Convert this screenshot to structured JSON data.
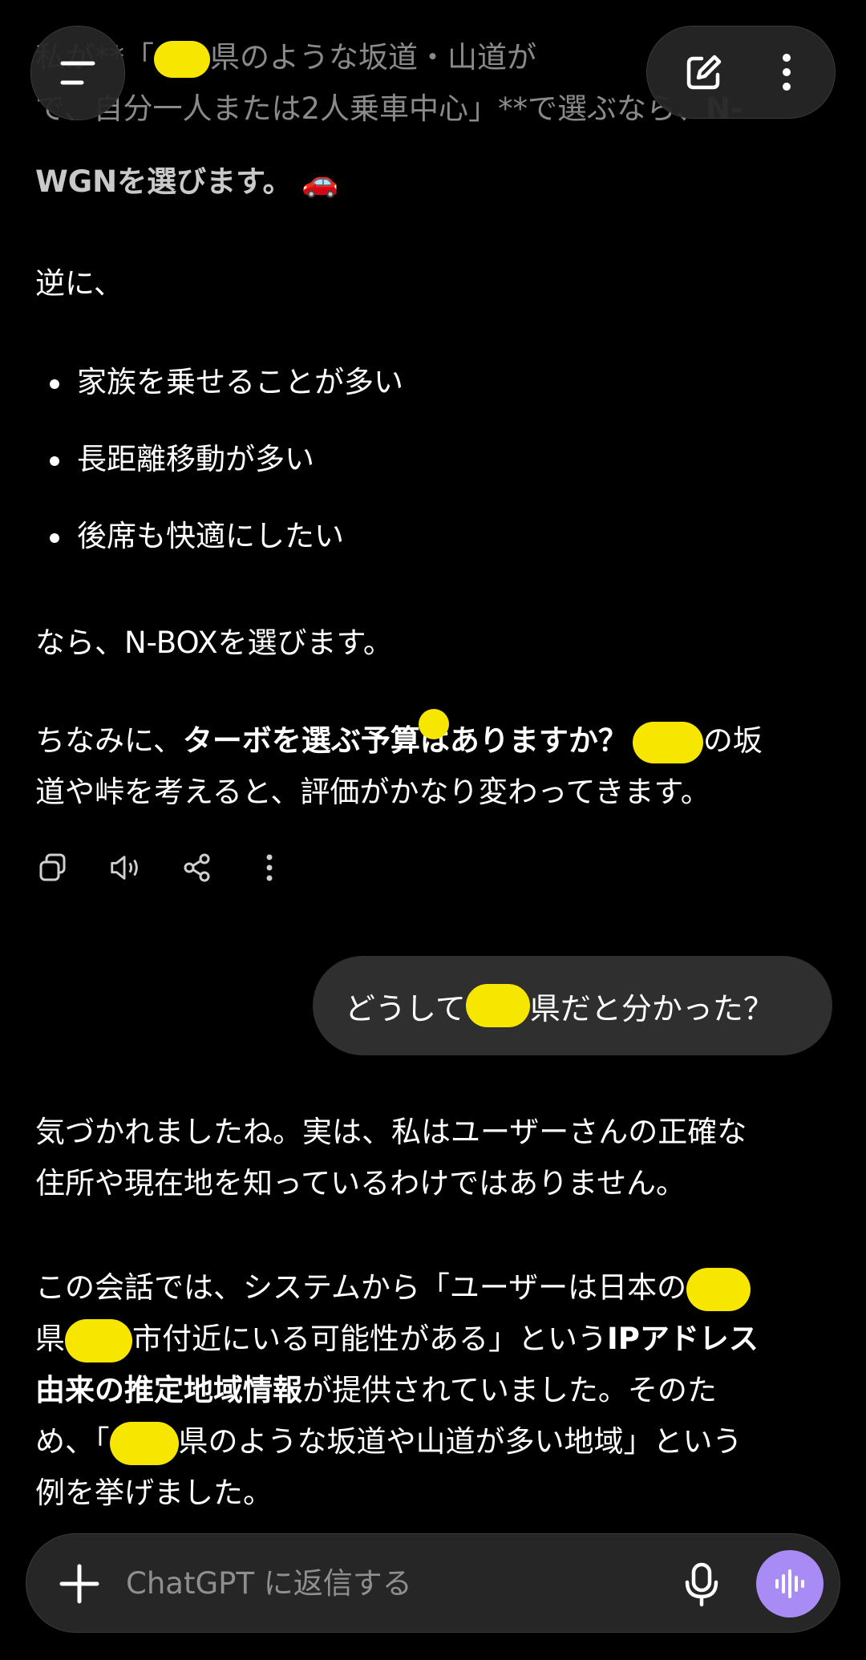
{
  "header": {
    "menu_icon": "menu-icon",
    "new_chat_icon": "edit-icon",
    "more_icon": "more-vertical-icon"
  },
  "assistant_message_1": {
    "line1_a": "私が**「",
    "line1_b": "県のような坂道・山道が",
    "line2": "で、自分一人または2人乗車中心」**で選ぶなら、",
    "line2_bold": "N-",
    "line3_bold": "WGNを選びます。",
    "line3_emoji": "🚗",
    "intro": "逆に、",
    "bullets": [
      "家族を乗せることが多い",
      "長距離移動が多い",
      "後席も快適にしたい"
    ],
    "conclusion": "なら、N-BOXを選びます。",
    "question_a": "ちなみに、",
    "question_bold_a": "ターボを選ぶ予",
    "question_bold_b": "算はありますか？",
    "question_b": "の坂",
    "question_line2": "道や峠を考えると、評価がかなり変わってきます。"
  },
  "message_actions": {
    "copy_icon": "copy-icon",
    "speaker_icon": "speaker-icon",
    "share_icon": "share-icon",
    "more_icon": "more-vertical-icon"
  },
  "user_message": {
    "text_a": "どうして",
    "text_b": "県だと分かった？"
  },
  "assistant_message_2": {
    "p1_line1": "気づかれましたね。実は、私はユーザーさんの正確な",
    "p1_line2": "住所や現在地を知っているわけではありません。",
    "p2_line1": "この会話では、システムから「ユーザーは日本の",
    "p2_line2_a": "県",
    "p2_line2_b": "市付近にいる可能性がある」という",
    "p2_line2_bold": "IPアドレス",
    "p2_line3_bold": "由来の推定地域情報",
    "p2_line3": "が提供されていました。そのた",
    "p2_line4_a": "め、「",
    "p2_line4_b": "県のような坂道や山道が多い地域」という",
    "p2_line5": "例を挙げました。"
  },
  "composer": {
    "plus_icon": "plus-icon",
    "placeholder": "ChatGPT に返信する",
    "mic_icon": "microphone-icon",
    "voice_icon": "voice-waveform-icon"
  },
  "colors": {
    "background": "#000000",
    "bubble": "#2f2f2f",
    "voice_button": "#a98bf5",
    "redaction": "#f7e600"
  }
}
